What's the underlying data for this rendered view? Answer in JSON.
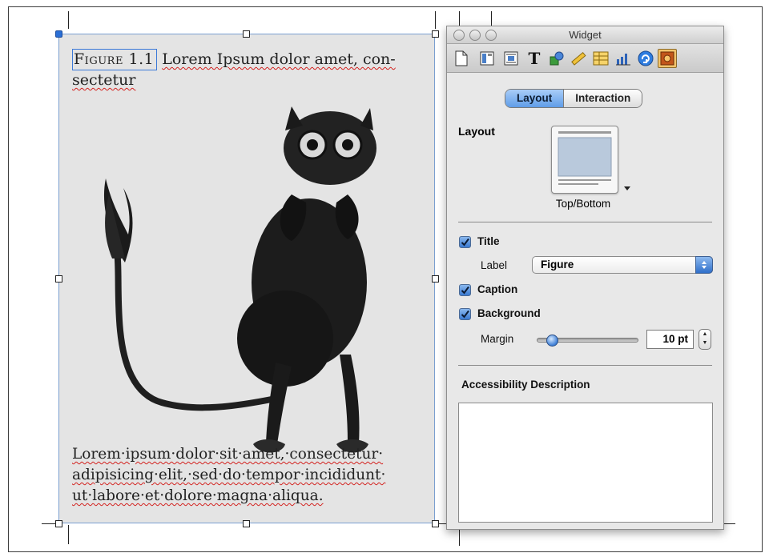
{
  "figure": {
    "label": "Figure 1.1",
    "title_rest_1": "Lorem Ipsum dolor amet, con-",
    "title_rest_2": "sectetur",
    "caption_line_1": "Lorem·ipsum·dolor·sit·amet,·consectetur·",
    "caption_line_2": "adipisicing·elit,·sed·do·tempor·incididunt·",
    "caption_line_3": "ut·labore·et·dolore·magna·aliqua."
  },
  "inspector": {
    "window_title": "Widget",
    "toolbar_icons": [
      "document-icon",
      "layout-icon",
      "text-wrap-icon",
      "text-icon",
      "graphic-icon",
      "metrics-icon",
      "table-icon",
      "chart-icon",
      "link-icon",
      "widget-icon"
    ],
    "active_tool": "widget-icon",
    "tabs": [
      "Layout",
      "Interaction"
    ],
    "active_tab": "Layout",
    "layout_section_label": "Layout",
    "layout_preview_caption": "Top/Bottom",
    "title_checkbox_label": "Title",
    "title_checked": true,
    "label_field_label": "Label",
    "label_selected_value": "Figure",
    "caption_checkbox_label": "Caption",
    "caption_checked": true,
    "background_checkbox_label": "Background",
    "background_checked": true,
    "margin_label": "Margin",
    "margin_value": "10 pt",
    "margin_slider_level": 0.1,
    "accessibility_label": "Accessibility Description",
    "accessibility_text": ""
  },
  "colors": {
    "accent_blue": "#3b79d8",
    "spell_red": "#d3221f",
    "active_tool_bg": "#f3c46c"
  }
}
